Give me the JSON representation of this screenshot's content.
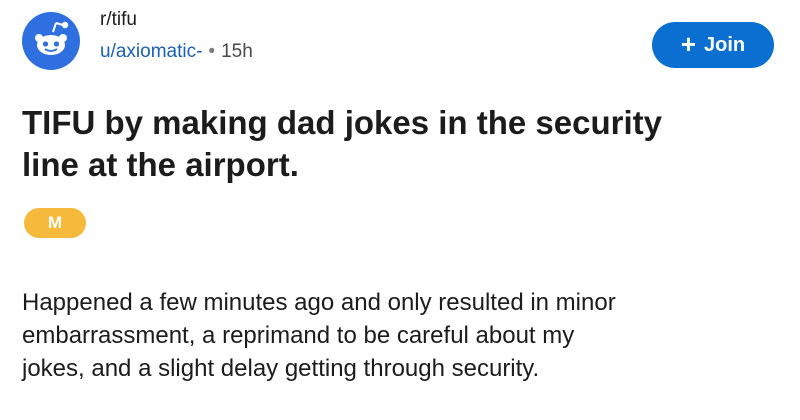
{
  "post": {
    "subreddit": "r/tifu",
    "author": "u/axiomatic-",
    "separator": "•",
    "age": "15h",
    "join_label": "Join",
    "join_icon": "+",
    "title_lines": [
      "TIFU by making dad jokes in the security",
      "line at the airport."
    ],
    "flair": "M",
    "body_lines": [
      "Happened a few minutes ago and only resulted in minor",
      "embarrassment, a reprimand to be careful about my",
      "jokes, and a slight delay getting through security."
    ]
  },
  "colors": {
    "accent": "#0a6fd0",
    "avatar": "#2f6fe0",
    "author_link": "#1a5fb4",
    "flair": "#f5b93b"
  },
  "icons": {
    "avatar": "reddit-snoo-icon",
    "join": "plus-icon"
  }
}
